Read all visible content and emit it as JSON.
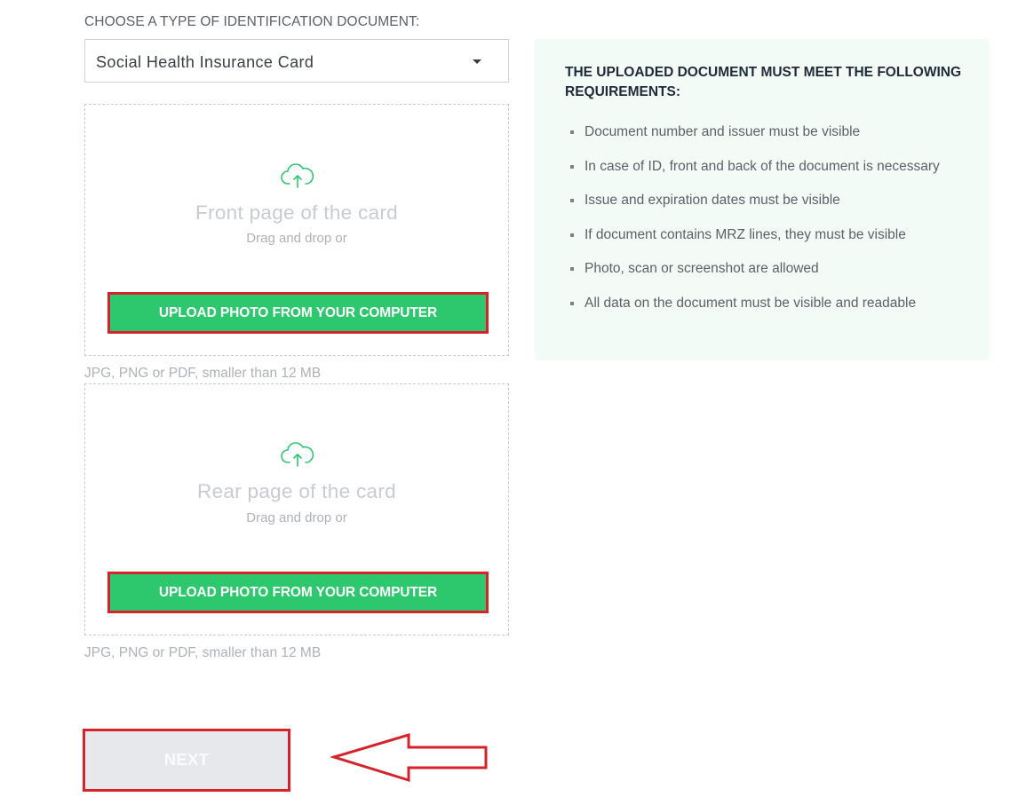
{
  "document_type": {
    "label": "CHOOSE A TYPE OF IDENTIFICATION DOCUMENT:",
    "selected": "Social Health Insurance Card"
  },
  "front_upload": {
    "title": "Front page of the card",
    "subtitle": "Drag and drop or",
    "button_label": "UPLOAD PHOTO FROM YOUR COMPUTER",
    "hint": "JPG, PNG or PDF, smaller than 12 MB"
  },
  "rear_upload": {
    "title": "Rear page of the card",
    "subtitle": "Drag and drop or",
    "button_label": "UPLOAD PHOTO FROM YOUR COMPUTER",
    "hint": "JPG, PNG or PDF, smaller than 12 MB"
  },
  "requirements": {
    "title": "THE UPLOADED DOCUMENT MUST MEET THE FOLLOWING REQUIREMENTS:",
    "items": [
      "Document number and issuer must be visible",
      "In case of ID, front and back of the document is necessary",
      "Issue and expiration dates must be visible",
      "If document contains MRZ lines, they must be visible",
      "Photo, scan or screenshot are allowed",
      "All data on the document must be visible and readable"
    ]
  },
  "next_button": {
    "label": "NEXT"
  },
  "colors": {
    "accent_green": "#2dc76d",
    "highlight_red": "#d5222b",
    "panel_bg": "#f3fbf6"
  },
  "icons": {
    "upload": "cloud-upload-icon",
    "select": "chevron-down-icon",
    "annotation": "arrow-left-icon"
  }
}
